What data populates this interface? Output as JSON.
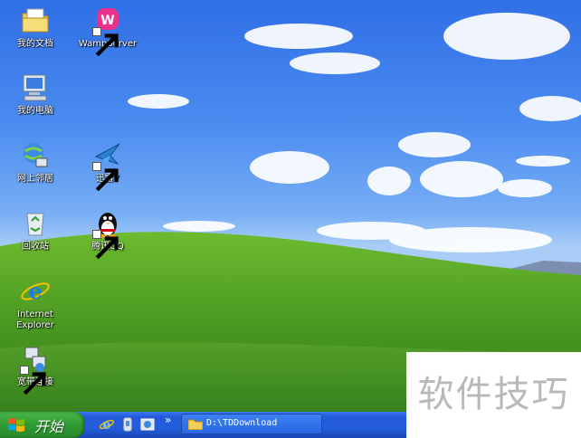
{
  "desktop": {
    "icons": [
      {
        "label": "我的文档",
        "icon": "my-documents-icon",
        "shortcut": false
      },
      {
        "label": "WampServer",
        "icon": "wampserver-icon",
        "shortcut": true
      },
      {
        "label": "我的电脑",
        "icon": "my-computer-icon",
        "shortcut": false
      },
      {
        "label": "网上邻居",
        "icon": "network-places-icon",
        "shortcut": false
      },
      {
        "label": "迅雷7",
        "icon": "thunder-icon",
        "shortcut": true
      },
      {
        "label": "回收站",
        "icon": "recycle-bin-icon",
        "shortcut": false
      },
      {
        "label": "腾讯QQ",
        "icon": "qq-penguin-icon",
        "shortcut": true
      },
      {
        "label": "Internet\nExplorer",
        "icon": "internet-explorer-icon",
        "shortcut": false
      },
      {
        "label": "宽带连接",
        "icon": "broadband-connection-icon",
        "shortcut": true
      }
    ]
  },
  "taskbar": {
    "start_label": "开始",
    "quick_launch": [
      "internet-explorer-icon",
      "media-icon",
      "show-desktop-icon"
    ],
    "overflow_chevron": "»",
    "task_button_label": "D:\\TDDownload"
  },
  "watermark": "软件技巧",
  "colors": {
    "sky": "#3b7fe8",
    "hill": "#4e9a26",
    "taskbar": "#245edb",
    "start": "#3aa23d"
  }
}
